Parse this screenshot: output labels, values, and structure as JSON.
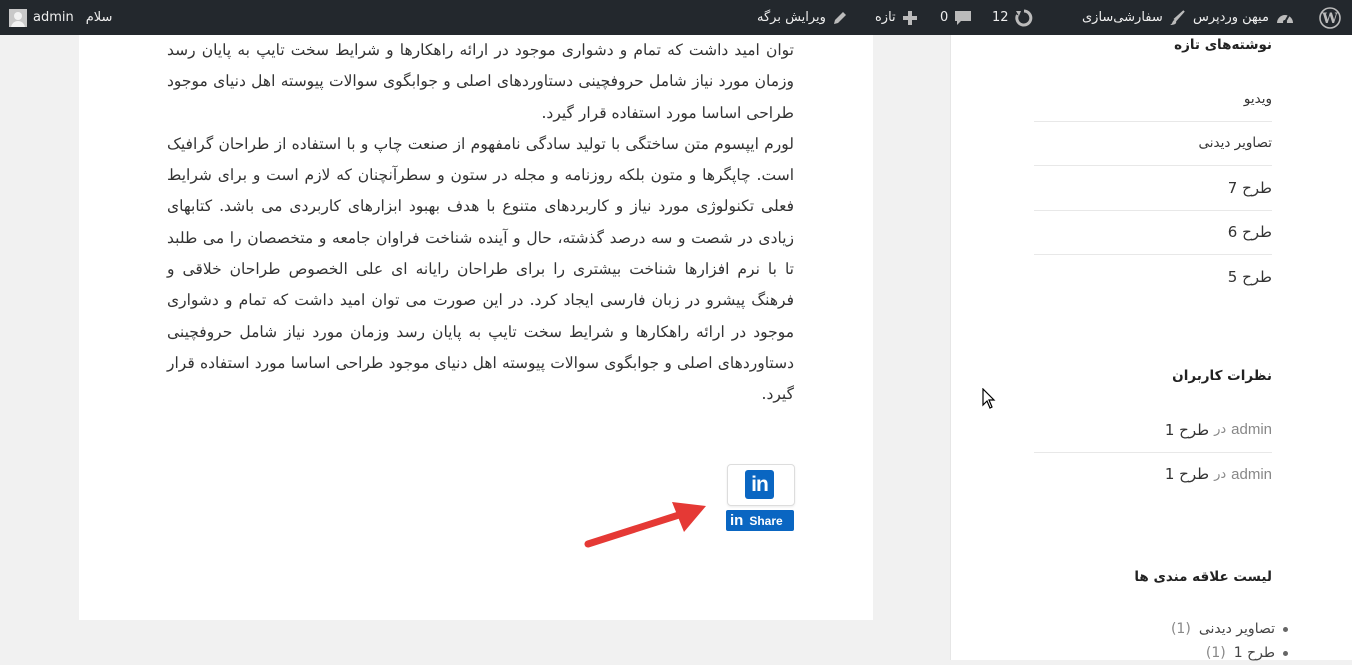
{
  "admin_bar": {
    "greeting": "سلام",
    "username": "admin",
    "site_name": "میهن وردپرس",
    "customize": "سفارشی‌سازی",
    "updates_count": "12",
    "comments_count": "0",
    "new_label": "تازه",
    "edit_page": "ویرایش برگه"
  },
  "article": {
    "paragraph_1": "توان امید داشت که تمام و دشواری موجود در ارائه راهکارها و شرایط سخت تایپ به پایان رسد وزمان مورد نیاز شامل حروفچینی دستاوردهای اصلی و جوابگوی سوالات پیوسته اهل دنیای موجود طراحی اساسا مورد استفاده قرار گیرد.",
    "paragraph_2": "لورم ایپسوم متن ساختگی با تولید سادگی نامفهوم از صنعت چاپ و با استفاده از طراحان گرافیک است. چاپگرها و متون بلکه روزنامه و مجله در ستون و سطرآنچنان که لازم است و برای شرایط فعلی تکنولوژی مورد نیاز و کاربردهای متنوع با هدف بهبود ابزارهای کاربردی می باشد. کتابهای زیادی در شصت و سه درصد گذشته، حال و آینده شناخت فراوان جامعه و متخصصان را می طلبد تا با نرم افزارها شناخت بیشتری را برای طراحان رایانه ای علی الخصوص طراحان خلاقی و فرهنگ پیشرو در زبان فارسی ایجاد کرد. در این صورت می توان امید داشت که تمام و دشواری موجود در ارائه راهکارها و شرایط سخت تایپ به پایان رسد وزمان مورد نیاز شامل حروفچینی دستاوردهای اصلی و جوابگوی سوالات پیوسته اهل دنیای موجود طراحی اساسا مورد استفاده قرار گیرد."
  },
  "share": {
    "logo_text": "in",
    "button_label": "Share",
    "brand_color": "#0a66c2"
  },
  "sidebar": {
    "recent_posts": {
      "title": "نوشته‌های تازه",
      "items": [
        "ویدیو",
        "تصاویر دیدنی",
        "طرح 7",
        "طرح 6",
        "طرح 5"
      ]
    },
    "recent_comments": {
      "title": "نظرات کاربران",
      "items": [
        {
          "author": "admin",
          "connector": "در",
          "post": "طرح 1"
        },
        {
          "author": "admin",
          "connector": "در",
          "post": "طرح 1"
        }
      ]
    },
    "wishlist": {
      "title": "لیست علاقه مندی ها",
      "items": [
        {
          "label": "تصاویر دیدنی",
          "count": "(1)"
        },
        {
          "label": "طرح 1",
          "count": "(1)"
        }
      ]
    }
  }
}
